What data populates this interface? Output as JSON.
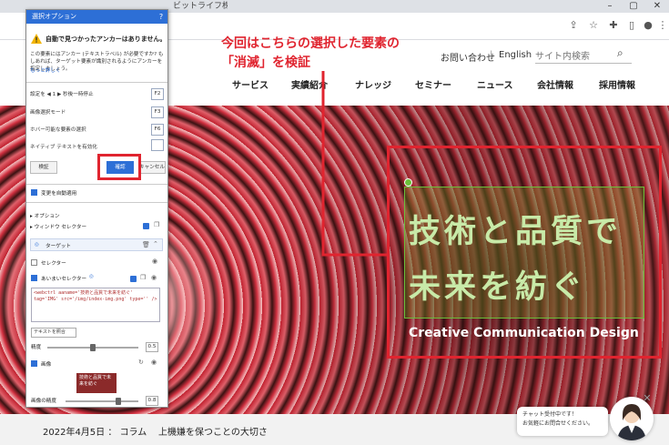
{
  "browser": {
    "tab_title": "ビットライフ株式会社",
    "window_controls": [
      "–",
      "▢",
      "✕"
    ],
    "toolbar_icons": [
      "share-icon",
      "star-icon",
      "extensions-icon",
      "sidepanel-icon",
      "profile-icon",
      "menu-icon"
    ]
  },
  "site": {
    "toplinks": {
      "contact": "お問い合わせ",
      "divider": "|",
      "english": "English"
    },
    "search": {
      "placeholder": "サイト内検索"
    },
    "nav": [
      "サービス",
      "実績紹介",
      "ナレッジ",
      "セミナー",
      "ニュース",
      "会社情報",
      "採用情報"
    ],
    "hero": {
      "line1": "技術と品質で",
      "line2": "未来を紡ぐ",
      "subtitle": "Creative Communication Design"
    },
    "news": {
      "date": "2022年4月5日",
      "sep": "：",
      "category": "コラム",
      "title": "上機嫌を保つことの大切さ"
    },
    "chat": {
      "line1": "チャット受付中です！",
      "line2": "お気軽にお問合せください。"
    }
  },
  "annotation": {
    "line1": "今回はこちらの選択した要素の",
    "line2": "「消滅」を検証"
  },
  "dialog": {
    "title": "選択オプション",
    "help": "?",
    "warning_title": "自動で見つかったアンカーはありません。",
    "warning_body": "この要素にはアンカー (テキストラベル) が必要ですか? もしあれば、ターゲット要素が識別されるようにアンカーを指定しましょう。",
    "more_link": "もっと詳しく",
    "options": [
      {
        "label": "設定を ◀ 1 ▶ 秒後一時停止",
        "key": "F2"
      },
      {
        "label": "画像選択モード",
        "key": "F3"
      },
      {
        "label": "ホバー可能な要素の選択",
        "key": "F6"
      },
      {
        "label": "ネイティブ テキストを有効化",
        "key": ""
      }
    ],
    "buttons": {
      "verify": "検証",
      "ok": "確認",
      "cancel": "キャンセル"
    },
    "auto_apply": "変更を自動適用",
    "sections": {
      "options": "オプション",
      "window_selector": "ウィンドウ セレクター"
    },
    "target": "ターゲット",
    "selector_label": "セレクター",
    "fuzzy_selector_label": "あいまいセレクター",
    "xpath": "<webctrl aaname='技術と品質で未来を紡ぐ' tag='IMG' src='/img/index-img.png' type='' />",
    "text_match": "テキストを照合",
    "accuracy_label": "精度",
    "accuracy_value": "0.5",
    "image_label": "画像",
    "image_thumb_text": "技術と品質で未来を紡ぐ",
    "image_accuracy_label": "画像の精度",
    "image_accuracy_value": "0.8"
  },
  "colors": {
    "accent_red": "#e0242f",
    "dialog_blue": "#2d6fd6",
    "overlay_green": "#6bbf3a"
  }
}
